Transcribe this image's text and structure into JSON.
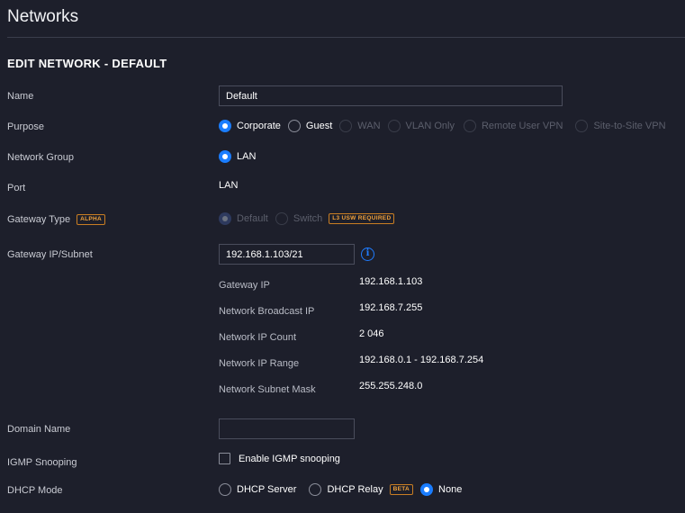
{
  "page": {
    "title": "Networks"
  },
  "section": {
    "title": "EDIT NETWORK - DEFAULT"
  },
  "fields": {
    "name": {
      "label": "Name",
      "value": "Default"
    },
    "purpose": {
      "label": "Purpose",
      "options": [
        {
          "label": "Corporate",
          "selected": true,
          "enabled": true
        },
        {
          "label": "Guest",
          "selected": false,
          "enabled": true
        },
        {
          "label": "WAN",
          "selected": false,
          "enabled": false
        },
        {
          "label": "VLAN Only",
          "selected": false,
          "enabled": false
        },
        {
          "label": "Remote User VPN",
          "selected": false,
          "enabled": false
        },
        {
          "label": "Site-to-Site VPN",
          "selected": false,
          "enabled": false
        }
      ]
    },
    "network_group": {
      "label": "Network Group",
      "option": "LAN"
    },
    "port": {
      "label": "Port",
      "value": "LAN"
    },
    "gateway_type": {
      "label": "Gateway Type",
      "badge": "ALPHA",
      "option_default": "Default",
      "option_switch": "Switch",
      "switch_badge": "L3 USW REQUIRED"
    },
    "gateway_ip_subnet": {
      "label": "Gateway IP/Subnet",
      "value": "192.168.1.103/21",
      "info_icon": "info-icon",
      "details": [
        {
          "label": "Gateway IP",
          "value": "192.168.1.103"
        },
        {
          "label": "Network Broadcast IP",
          "value": "192.168.7.255"
        },
        {
          "label": "Network IP Count",
          "value": "2 046"
        },
        {
          "label": "Network IP Range",
          "value": "192.168.0.1 - 192.168.7.254"
        },
        {
          "label": "Network Subnet Mask",
          "value": "255.255.248.0"
        }
      ]
    },
    "domain_name": {
      "label": "Domain Name",
      "value": ""
    },
    "igmp_snooping": {
      "label": "IGMP Snooping",
      "checkbox_label": "Enable IGMP snooping",
      "checked": false
    },
    "dhcp_mode": {
      "label": "DHCP Mode",
      "options": [
        {
          "label": "DHCP Server",
          "selected": false
        },
        {
          "label": "DHCP Relay",
          "selected": false,
          "badge": "BETA"
        },
        {
          "label": "None",
          "selected": true
        }
      ]
    }
  },
  "colors": {
    "background": "#1d1f2b",
    "accent": "#1a7dff",
    "badge": "#f2a23a",
    "divider": "#3a3d4c"
  }
}
